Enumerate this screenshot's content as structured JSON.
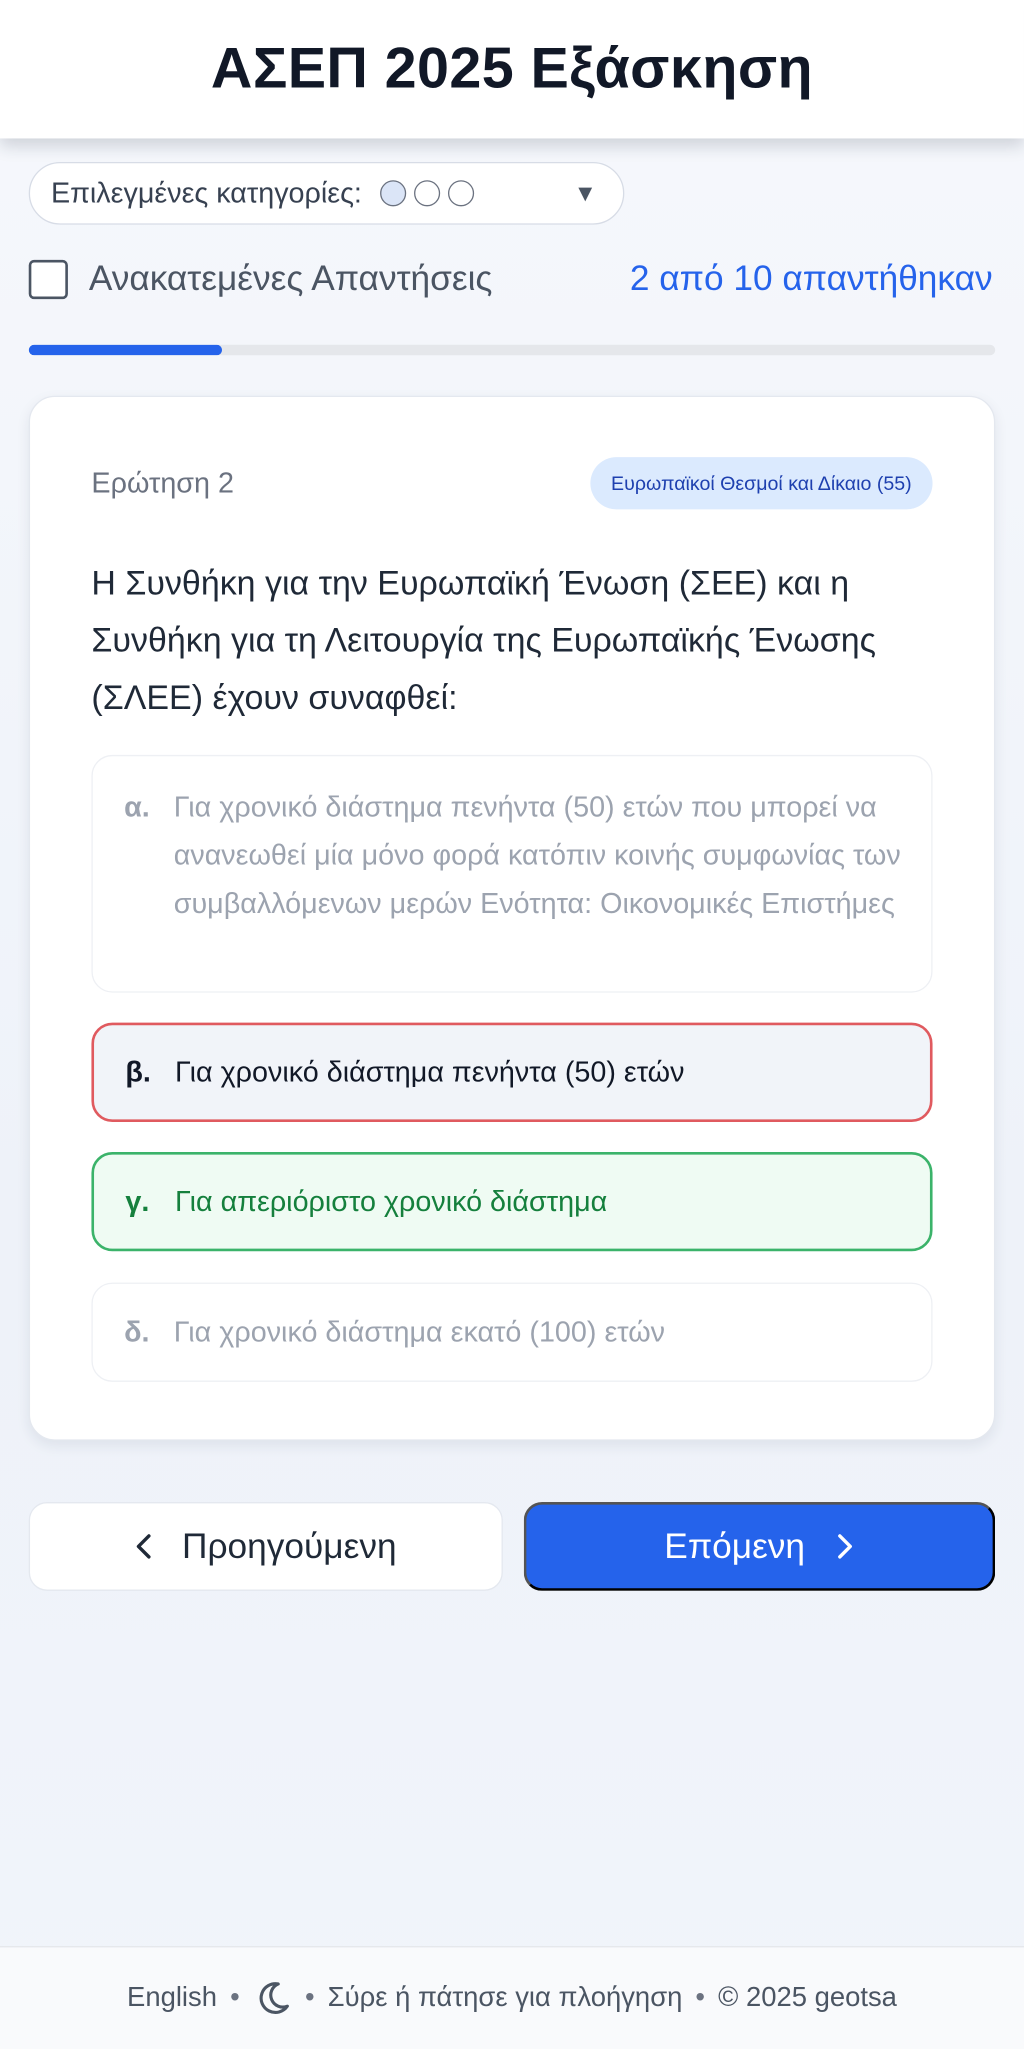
{
  "header": {
    "title": "ΑΣΕΠ 2025 Εξάσκηση"
  },
  "filter": {
    "label": "Επιλεγμένες κατηγορίες:",
    "caret": "▼"
  },
  "shuffle": {
    "label": "Ανακατεμένες Απαντήσεις",
    "checked": false
  },
  "progress": {
    "text": "2 από 10 απαντήθηκαν",
    "fraction": 0.2
  },
  "question": {
    "number_label": "Ερώτηση 2",
    "category": "Ευρωπαϊκοί Θεσμοί και Δίκαιο (55)",
    "text": "Η Συνθήκη για την Ευρωπαϊκή Ένωση (ΣΕΕ) και η Συνθήκη για τη Λειτουργία της Ευρωπαϊκής Ένωσης (ΣΛΕΕ) έχουν συναφθεί:",
    "options": [
      {
        "letter": "α.",
        "text": "Για χρονικό διάστημα πενήντα (50) ετών που μπορεί να ανανεωθεί μία μόνο φορά κατόπιν κοινής συμφωνίας των συμβαλλόμενων μερών Ενότητα: Οικονομικές Επιστήμες",
        "state": "neutral"
      },
      {
        "letter": "β.",
        "text": "Για χρονικό διάστημα πενήντα (50) ετών",
        "state": "wrong-selected"
      },
      {
        "letter": "γ.",
        "text": "Για απεριόριστο χρονικό διάστημα",
        "state": "correct"
      },
      {
        "letter": "δ.",
        "text": "Για χρονικό διάστημα εκατό (100) ετών",
        "state": "neutral"
      }
    ]
  },
  "nav": {
    "prev_label": "Προηγούμενη",
    "next_label": "Επόμενη"
  },
  "footer": {
    "language": "English",
    "hint": "Σύρε ή πάτησε για πλοήγηση",
    "copyright": "© 2025 geotsa",
    "separator": "•"
  },
  "colors": {
    "accent": "#2563eb",
    "wrong": "#e05a5f",
    "correct": "#3bb36a",
    "correct_text": "#15803d"
  }
}
